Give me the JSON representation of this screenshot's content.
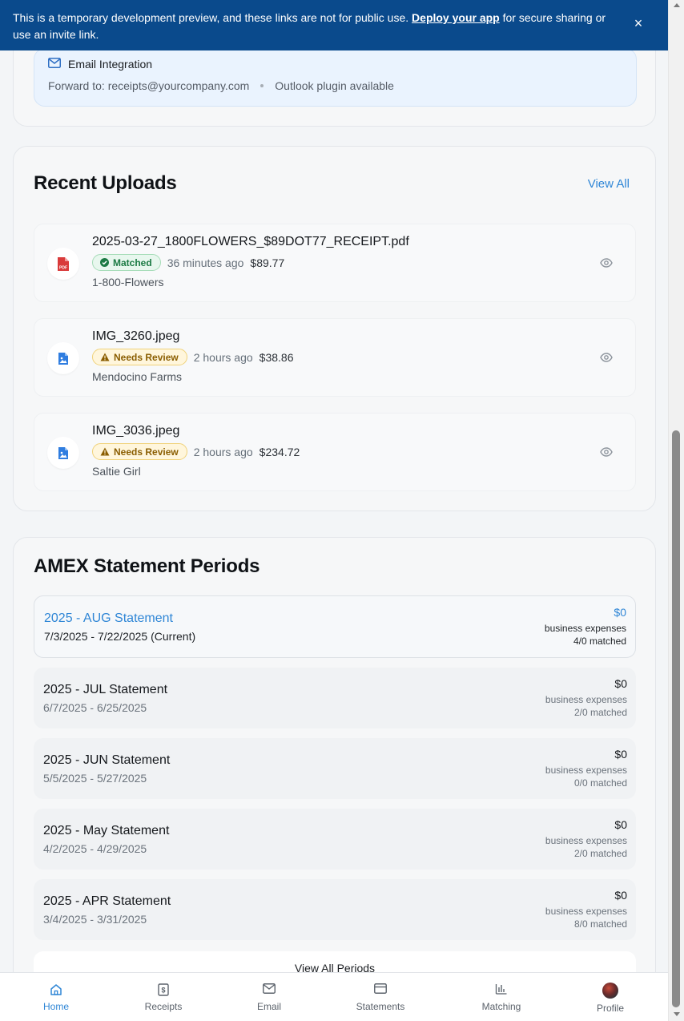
{
  "banner": {
    "text_before": "This is a temporary development preview, and these links are not for public use. ",
    "link": "Deploy your app",
    "text_after": " for secure sharing or use an invite link.",
    "close_label": "×"
  },
  "email_integration": {
    "title": "Email Integration",
    "forward": "Forward to: receipts@yourcompany.com",
    "plugin": "Outlook plugin available"
  },
  "recent_uploads": {
    "title": "Recent Uploads",
    "view_all": "View All",
    "items": [
      {
        "file": "2025-03-27_1800FLOWERS_$89DOT77_RECEIPT.pdf",
        "status": "Matched",
        "time": "36 minutes ago",
        "amount": "$89.77",
        "merchant": "1-800-Flowers",
        "icon": "pdf-file-icon"
      },
      {
        "file": "IMG_3260.jpeg",
        "status": "Needs Review",
        "time": "2 hours ago",
        "amount": "$38.86",
        "merchant": "Mendocino Farms",
        "icon": "image-file-icon"
      },
      {
        "file": "IMG_3036.jpeg",
        "status": "Needs Review",
        "time": "2 hours ago",
        "amount": "$234.72",
        "merchant": "Saltie Girl",
        "icon": "image-file-icon"
      }
    ]
  },
  "statement_periods": {
    "title": "AMEX Statement Periods",
    "items": [
      {
        "name": "2025 - AUG Statement",
        "dates": "7/3/2025 - 7/22/2025 (Current)",
        "amount": "$0",
        "label": "business expenses",
        "matched": "4/0 matched"
      },
      {
        "name": "2025 - JUL Statement",
        "dates": "6/7/2025 - 6/25/2025",
        "amount": "$0",
        "label": "business expenses",
        "matched": "2/0 matched"
      },
      {
        "name": "2025 - JUN Statement",
        "dates": "5/5/2025 - 5/27/2025",
        "amount": "$0",
        "label": "business expenses",
        "matched": "0/0 matched"
      },
      {
        "name": "2025 - May Statement",
        "dates": "4/2/2025 - 4/29/2025",
        "amount": "$0",
        "label": "business expenses",
        "matched": "2/0 matched"
      },
      {
        "name": "2025 - APR Statement",
        "dates": "3/4/2025 - 3/31/2025",
        "amount": "$0",
        "label": "business expenses",
        "matched": "8/0 matched"
      }
    ],
    "view_all": "View All Periods"
  },
  "nav": {
    "items": [
      {
        "label": "Home",
        "icon": "home-icon",
        "active": true
      },
      {
        "label": "Receipts",
        "icon": "receipt-icon"
      },
      {
        "label": "Email",
        "icon": "mail-icon"
      },
      {
        "label": "Statements",
        "icon": "credit-card-icon"
      },
      {
        "label": "Matching",
        "icon": "bar-chart-icon"
      },
      {
        "label": "Profile",
        "icon": "avatar"
      }
    ]
  },
  "colors": {
    "banner": "#0a4a8c",
    "accent": "#2f86d6",
    "matched": "#1c7a44",
    "review": "#8a5d00",
    "pdf_icon": "#d93a3a",
    "image_icon": "#2f7de0"
  }
}
